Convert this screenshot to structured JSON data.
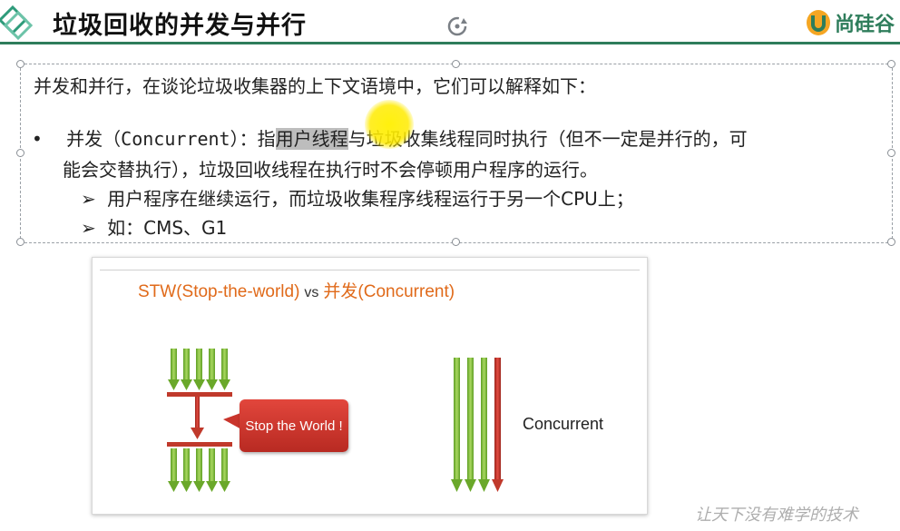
{
  "header": {
    "title": "垃圾回收的并发与并行",
    "brand": "尚硅谷"
  },
  "content": {
    "intro": "并发和并行，在谈论垃圾收集器的上下文语境中，它们可以解释如下：",
    "bullet_prefix": "并发（",
    "bullet_term": "Concurrent",
    "bullet_mid": "）：指",
    "bullet_highlight": "用户线程",
    "bullet_rest": "与垃圾收集线程同时执行（但不一定是并行的，可",
    "bullet_cont": "能会交替执行），垃圾回收线程在执行时不会停顿用户程序的运行。",
    "sub_items": [
      "用户程序在继续运行，而垃圾收集程序线程运行于另一个CPU上；",
      "如：CMS、G1"
    ]
  },
  "diagram": {
    "title_left": "STW(Stop-the-world)",
    "title_vs": "vs",
    "title_right": "并发(Concurrent)",
    "bubble": "Stop the World !",
    "concurrent_label": "Concurrent",
    "colors": {
      "green": "#7cbb3a",
      "red": "#c0392b",
      "orange": "#e06a1a"
    }
  },
  "watermark": "让天下没有难学的技术"
}
